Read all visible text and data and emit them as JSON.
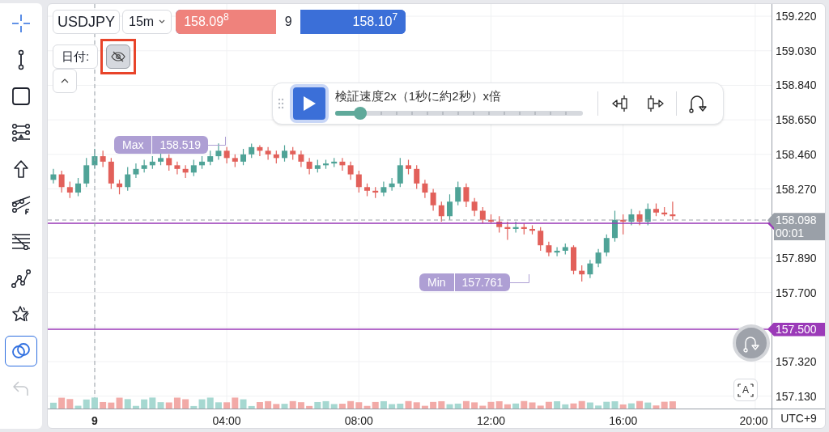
{
  "toolbar": {
    "items": [
      {
        "kind": "crosshair",
        "on": false,
        "disabled": false
      },
      {
        "kind": "segment",
        "on": false,
        "disabled": false
      },
      {
        "kind": "rectangle",
        "on": false,
        "disabled": false
      },
      {
        "kind": "nodes",
        "on": false,
        "disabled": false
      },
      {
        "kind": "arrow",
        "on": false,
        "disabled": false
      },
      {
        "kind": "fib",
        "on": false,
        "disabled": false
      },
      {
        "kind": "channel",
        "on": false,
        "disabled": false
      },
      {
        "kind": "pattern",
        "on": false,
        "disabled": false
      },
      {
        "kind": "star",
        "on": false,
        "disabled": false
      },
      {
        "kind": "overlap",
        "on": true,
        "disabled": false
      },
      {
        "kind": "undo",
        "on": false,
        "disabled": true
      }
    ]
  },
  "header": {
    "symbol": "USDJPY",
    "interval": "15m",
    "quote": {
      "bid": "158.09$^{8}$",
      "spread": "9",
      "ask": "158.10$^{7}$"
    },
    "date_label": "日付:",
    "hide_toggle": {
      "on": true
    }
  },
  "replay": {
    "title": "検証速度2x（1秒に約2秒）x倍",
    "level": 0.1
  },
  "chart": {
    "chart_data": {
      "type": "candlestick",
      "x": [
        -1.25,
        -1,
        -0.75,
        -0.5,
        -0.25,
        0,
        0.25,
        0.5,
        0.75,
        1,
        1.25,
        1.5,
        1.75,
        2,
        2.25,
        2.5,
        2.75,
        3,
        3.25,
        3.5,
        3.75,
        4,
        4.25,
        4.5,
        4.75,
        5,
        5.25,
        5.5,
        5.75,
        6,
        6.25,
        6.5,
        6.75,
        7,
        7.25,
        7.5,
        7.75,
        8,
        8.25,
        8.5,
        8.75,
        9,
        9.25,
        9.5,
        9.75,
        10,
        10.25,
        10.5,
        10.75,
        11,
        11.25,
        11.5,
        11.75,
        12,
        12.25,
        12.5,
        12.75,
        13,
        13.25,
        13.5,
        13.75,
        14,
        14.25,
        14.5,
        14.75,
        15,
        15.25,
        15.5,
        15.75,
        16,
        16.25,
        16.5,
        16.75,
        17,
        17.25,
        17.5
      ],
      "ohlc": [
        [
          158.32,
          158.38,
          158.3,
          158.35
        ],
        [
          158.35,
          158.37,
          158.25,
          158.28
        ],
        [
          158.28,
          158.31,
          158.22,
          158.25
        ],
        [
          158.25,
          158.33,
          158.23,
          158.3
        ],
        [
          158.3,
          158.44,
          158.28,
          158.4
        ],
        [
          158.4,
          158.49,
          158.38,
          158.45
        ],
        [
          158.45,
          158.48,
          158.39,
          158.42
        ],
        [
          158.42,
          158.44,
          158.27,
          158.3
        ],
        [
          158.3,
          158.32,
          158.24,
          158.28
        ],
        [
          158.28,
          158.39,
          158.26,
          158.35
        ],
        [
          158.35,
          158.41,
          158.33,
          158.38
        ],
        [
          158.38,
          158.43,
          158.36,
          158.4
        ],
        [
          158.4,
          158.45,
          158.38,
          158.42
        ],
        [
          158.42,
          158.47,
          158.4,
          158.44
        ],
        [
          158.44,
          158.46,
          158.37,
          158.4
        ],
        [
          158.4,
          158.42,
          158.35,
          158.38
        ],
        [
          158.38,
          158.4,
          158.33,
          158.36
        ],
        [
          158.36,
          158.43,
          158.34,
          158.4
        ],
        [
          158.4,
          158.45,
          158.38,
          158.42
        ],
        [
          158.42,
          158.48,
          158.4,
          158.45
        ],
        [
          158.45,
          158.52,
          158.43,
          158.48
        ],
        [
          158.48,
          158.5,
          158.41,
          158.44
        ],
        [
          158.44,
          158.46,
          158.39,
          158.42
        ],
        [
          158.42,
          158.49,
          158.4,
          158.46
        ],
        [
          158.46,
          158.519,
          158.44,
          158.5
        ],
        [
          158.5,
          158.51,
          158.45,
          158.48
        ],
        [
          158.48,
          158.5,
          158.43,
          158.46
        ],
        [
          158.46,
          158.48,
          158.41,
          158.44
        ],
        [
          158.44,
          158.51,
          158.42,
          158.48
        ],
        [
          158.48,
          158.5,
          158.43,
          158.46
        ],
        [
          158.46,
          158.48,
          158.39,
          158.42
        ],
        [
          158.42,
          158.44,
          158.35,
          158.38
        ],
        [
          158.38,
          158.43,
          158.36,
          158.4
        ],
        [
          158.4,
          158.43,
          158.38,
          158.41
        ],
        [
          158.41,
          158.44,
          158.39,
          158.42
        ],
        [
          158.42,
          158.44,
          158.37,
          158.4
        ],
        [
          158.4,
          158.42,
          158.32,
          158.35
        ],
        [
          158.35,
          158.37,
          158.25,
          158.28
        ],
        [
          158.28,
          158.3,
          158.23,
          158.26
        ],
        [
          158.26,
          158.28,
          158.22,
          158.25
        ],
        [
          158.25,
          158.31,
          158.23,
          158.28
        ],
        [
          158.28,
          158.33,
          158.26,
          158.3
        ],
        [
          158.3,
          158.44,
          158.28,
          158.4
        ],
        [
          158.4,
          158.43,
          158.35,
          158.38
        ],
        [
          158.38,
          158.4,
          158.27,
          158.3
        ],
        [
          158.3,
          158.32,
          158.22,
          158.25
        ],
        [
          158.25,
          158.27,
          158.15,
          158.18
        ],
        [
          158.18,
          158.2,
          158.09,
          158.12
        ],
        [
          158.12,
          158.24,
          158.1,
          158.2
        ],
        [
          158.2,
          158.31,
          158.18,
          158.28
        ],
        [
          158.28,
          158.3,
          158.17,
          158.2
        ],
        [
          158.2,
          158.22,
          158.12,
          158.15
        ],
        [
          158.15,
          158.17,
          158.08,
          158.1
        ],
        [
          158.1,
          158.13,
          158.08,
          158.09
        ],
        [
          158.09,
          158.12,
          158.03,
          158.06
        ],
        [
          158.06,
          158.09,
          157.99,
          158.05
        ],
        [
          158.05,
          158.09,
          158.03,
          158.06
        ],
        [
          158.06,
          158.08,
          158.02,
          158.05
        ],
        [
          158.05,
          158.07,
          158.02,
          158.04
        ],
        [
          158.04,
          158.06,
          157.93,
          157.96
        ],
        [
          157.96,
          157.98,
          157.9,
          157.92
        ],
        [
          157.92,
          157.95,
          157.9,
          157.93
        ],
        [
          157.93,
          157.97,
          157.91,
          157.95
        ],
        [
          157.95,
          157.96,
          157.8,
          157.82
        ],
        [
          157.82,
          157.85,
          157.761,
          157.8
        ],
        [
          157.8,
          157.88,
          157.78,
          157.86
        ],
        [
          157.86,
          157.94,
          157.84,
          157.92
        ],
        [
          157.92,
          158.02,
          157.9,
          158.0
        ],
        [
          158.0,
          158.15,
          157.98,
          158.1
        ],
        [
          158.1,
          158.13,
          158.02,
          158.09
        ],
        [
          158.09,
          158.16,
          158.07,
          158.13
        ],
        [
          158.13,
          158.15,
          158.07,
          158.09
        ],
        [
          158.09,
          158.19,
          158.07,
          158.16
        ],
        [
          158.16,
          158.19,
          158.12,
          158.14
        ],
        [
          158.14,
          158.17,
          158.12,
          158.13
        ],
        [
          158.13,
          158.2,
          158.1,
          158.12
        ]
      ],
      "yticks": [
        {
          "value": 159.22,
          "label": "159.220"
        },
        {
          "value": 159.03,
          "label": "159.030"
        },
        {
          "value": 158.84,
          "label": "158.840"
        },
        {
          "value": 158.65,
          "label": "158.650"
        },
        {
          "value": 158.46,
          "label": "158.460"
        },
        {
          "value": 158.27,
          "label": "158.270"
        },
        {
          "value": 157.89,
          "label": "157.890"
        },
        {
          "value": 157.7,
          "label": "157.700"
        },
        {
          "value": 157.32,
          "label": "157.320"
        },
        {
          "value": 157.13,
          "label": "157.130"
        }
      ],
      "xlim": [
        -1.42,
        22.16
      ],
      "ylim": [
        157.062,
        159.287
      ],
      "grid": true,
      "ref_lines": [
        {
          "axis": "y",
          "value": 158.098,
          "color": "#9aa0a8"
        },
        {
          "axis": "y",
          "value": 158.08,
          "color": "#9b3ab8"
        },
        {
          "axis": "y",
          "value": 157.5,
          "color": "#9b3ab8"
        },
        {
          "axis": "x",
          "value": 0,
          "color": "#9aa0a8"
        }
      ],
      "xticks": [
        {
          "value": 4,
          "label": "04:00"
        },
        {
          "value": 8,
          "label": "08:00"
        },
        {
          "value": 12,
          "label": "12:00"
        },
        {
          "value": 16,
          "label": "16:00"
        },
        {
          "value": 20,
          "label": "20:00"
        }
      ]
    },
    "day_label": "9",
    "timezone": "UTC+9",
    "max_label": {
      "name": "Max",
      "value": "158.519"
    },
    "min_label": {
      "name": "Min",
      "value": "157.761"
    },
    "last_price": {
      "price": "158.098",
      "countdown": "00:01"
    },
    "level_line": {
      "label": "157.500"
    },
    "auto_scale_button": "A"
  }
}
